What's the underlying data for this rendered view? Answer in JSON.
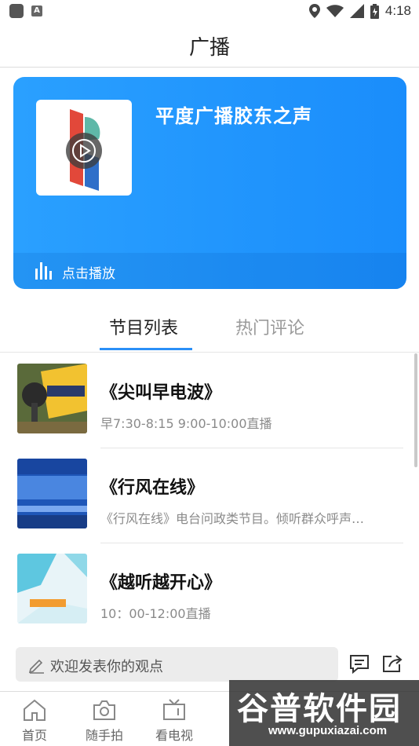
{
  "status_bar": {
    "time": "4:18"
  },
  "header": {
    "title": "广播"
  },
  "player": {
    "station_name": "平度广播胶东之声",
    "footer_label": "点击播放"
  },
  "tabs": [
    {
      "label": "节目列表",
      "active": true
    },
    {
      "label": "热门评论",
      "active": false
    }
  ],
  "programs": [
    {
      "title": "《尖叫早电波》",
      "desc": "早7:30-8:15 9:00-10:00直播"
    },
    {
      "title": "《行风在线》",
      "desc": "《行风在线》电台问政类节目。倾听群众呼声…"
    },
    {
      "title": "《越听越开心》",
      "desc": "10：00-12:00直播"
    }
  ],
  "comment": {
    "placeholder": "欢迎发表你的观点"
  },
  "nav": [
    {
      "label": "首页",
      "icon": "home-icon"
    },
    {
      "label": "随手拍",
      "icon": "camera-icon"
    },
    {
      "label": "看电视",
      "icon": "tv-icon"
    }
  ],
  "watermark": {
    "main": "谷普软件园",
    "url": "www.gupuxiazai.com"
  },
  "colors": {
    "accent": "#2a8ff7",
    "card": "#1a8dfb"
  }
}
